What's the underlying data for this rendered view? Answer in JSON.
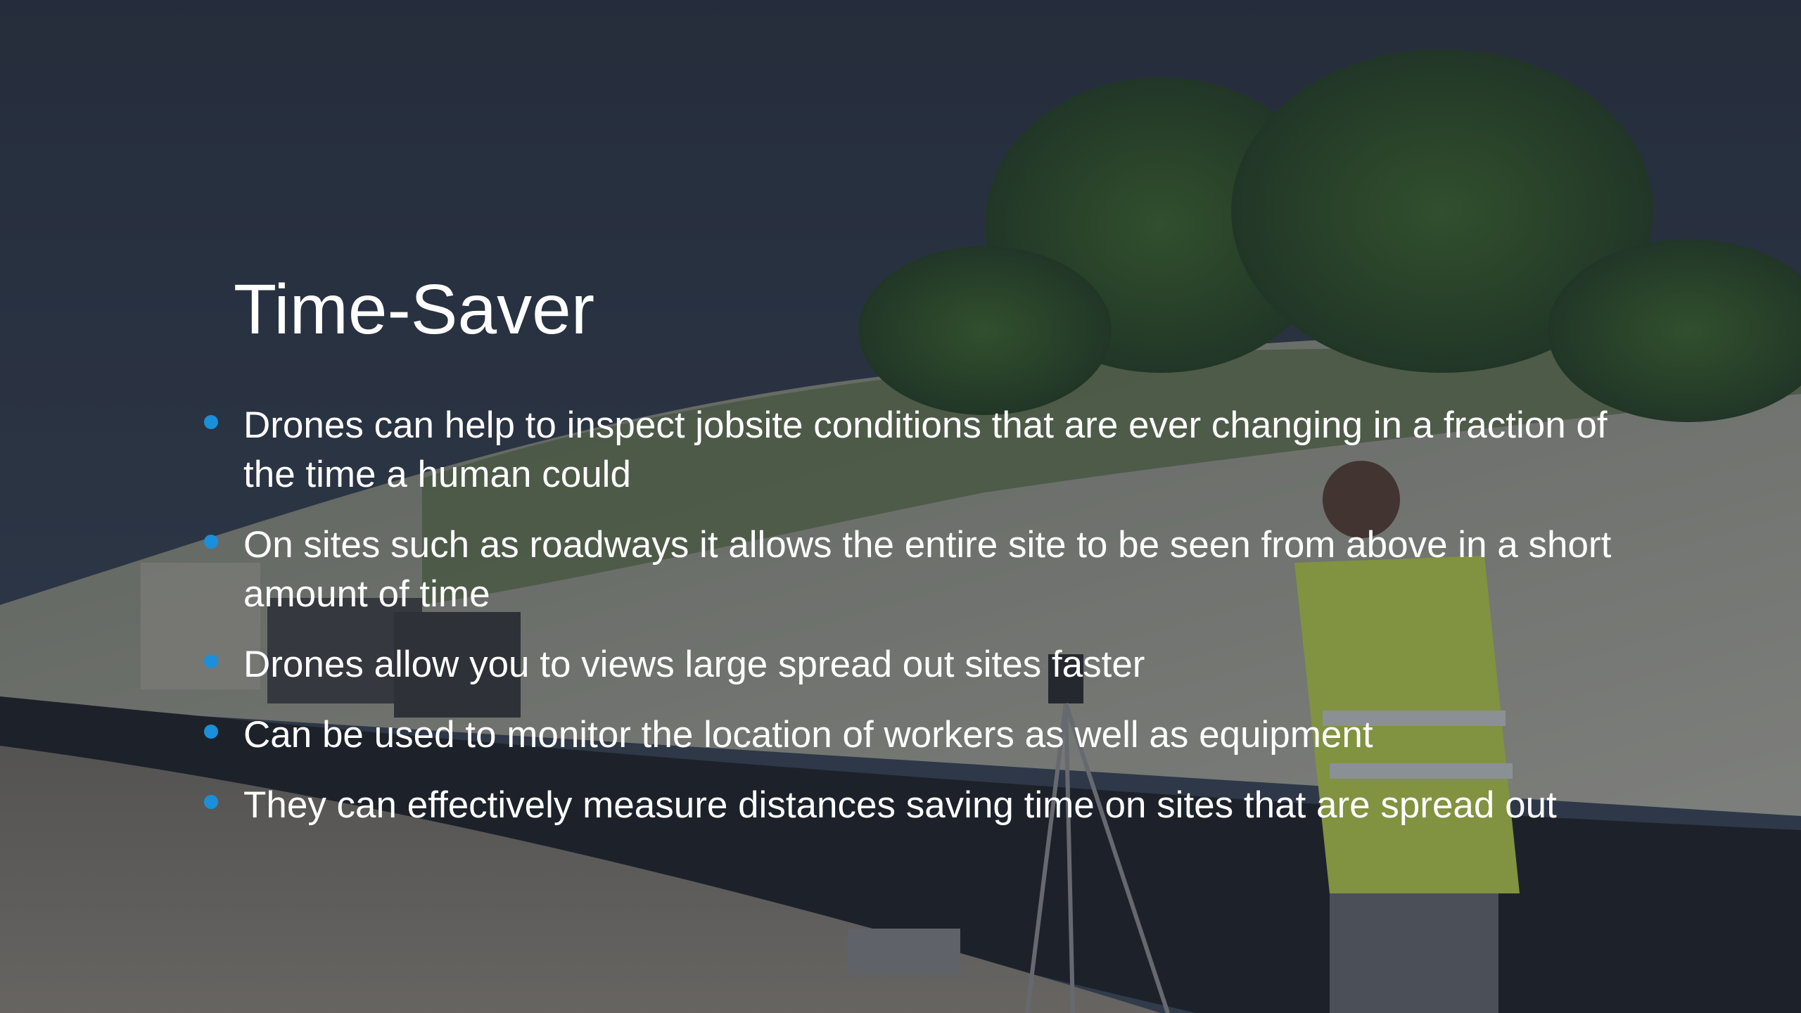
{
  "slide": {
    "title": "Time-Saver",
    "bullets": [
      {
        "text": "Drones can help to inspect jobsite conditions that are ever changing in a fraction of the time a human could"
      },
      {
        "text": "On sites such as roadways it allows the entire site to be seen from above in a short amount of time"
      },
      {
        "text": "Drones allow you to views large spread out sites faster"
      },
      {
        "text": "Can be used to monitor the location of workers as well as equipment"
      },
      {
        "text": "They can effectively measure distances saving time on sites that are spread out"
      }
    ]
  },
  "colors": {
    "bullet": "#1b8fd9",
    "text": "#ffffff",
    "overlay": "#1e2634"
  },
  "background": {
    "icon": "construction-site-photo"
  }
}
